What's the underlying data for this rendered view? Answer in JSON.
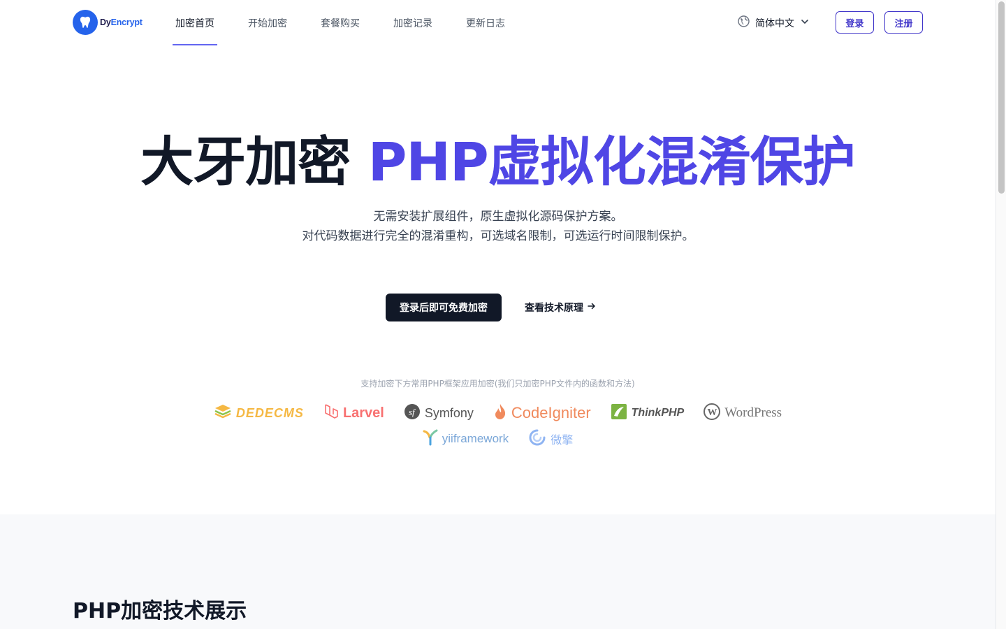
{
  "header": {
    "logo": {
      "part1": "Dy",
      "part2": "Encrypt"
    },
    "nav": [
      {
        "label": "加密首页",
        "active": true
      },
      {
        "label": "开始加密",
        "active": false
      },
      {
        "label": "套餐购买",
        "active": false
      },
      {
        "label": "加密记录",
        "active": false
      },
      {
        "label": "更新日志",
        "active": false
      }
    ],
    "language": "简体中文",
    "login_label": "登录",
    "register_label": "注册"
  },
  "hero": {
    "title_dark": "大牙加密",
    "title_accent": "PHP虚拟化混淆保护",
    "subtitle_line1": "无需安装扩展组件，原生虚拟化源码保护方案。",
    "subtitle_line2": "对代码数据进行完全的混淆重构，可选域名限制，可选运行时间限制保护。",
    "cta_primary": "登录后即可免费加密",
    "cta_secondary": "查看技术原理"
  },
  "frameworks": {
    "caption": "支持加密下方常用PHP框架应用加密(我们只加密PHP文件内的函数和方法)",
    "items": [
      {
        "name": "DEDECMS",
        "icon": "dedecms-logo"
      },
      {
        "name": "Larvel",
        "icon": "laravel-logo"
      },
      {
        "name": "Symfony",
        "icon": "symfony-logo"
      },
      {
        "name": "CodeIgniter",
        "icon": "codeigniter-logo"
      },
      {
        "name": "ThinkPHP",
        "icon": "thinkphp-logo"
      },
      {
        "name": "WordPress",
        "icon": "wordpress-logo"
      },
      {
        "name": "yiiframework",
        "icon": "yii-logo"
      },
      {
        "name": "微擎",
        "icon": "weiqing-logo"
      }
    ]
  },
  "section2": {
    "title": "PHP加密技术展示"
  },
  "colors": {
    "accent": "#4f46e5",
    "dark": "#111827",
    "brand_blue": "#2563eb"
  }
}
